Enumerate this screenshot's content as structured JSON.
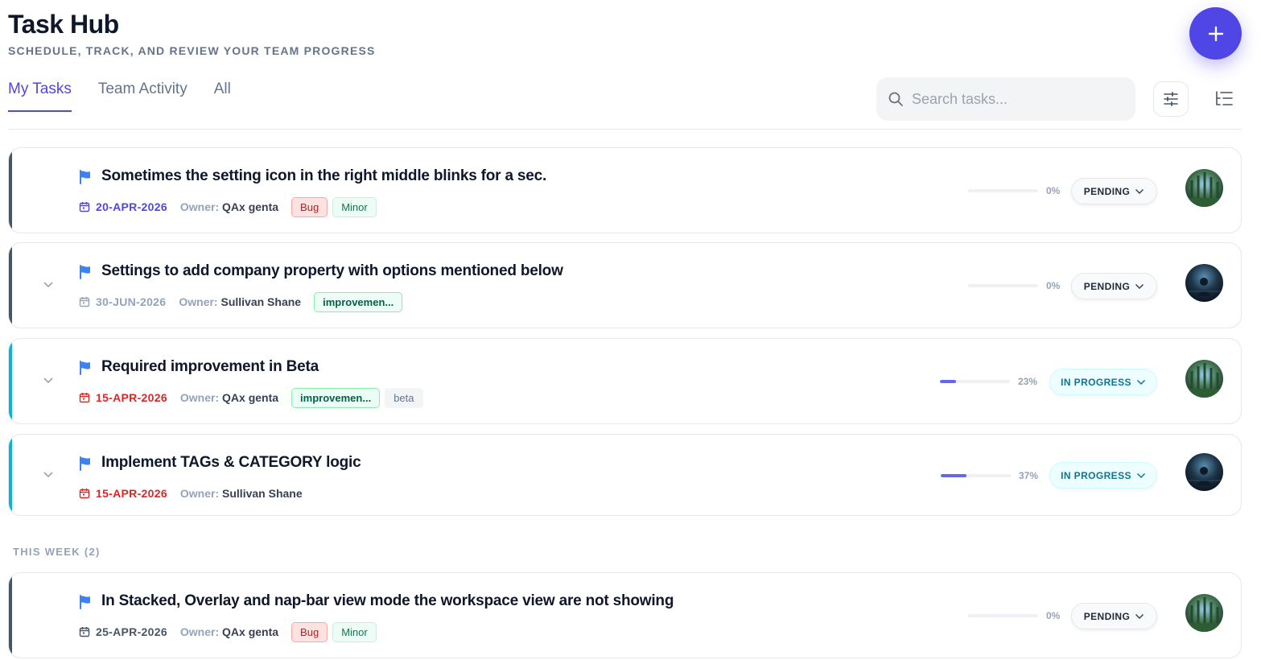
{
  "header": {
    "title": "Task Hub",
    "subtitle": "SCHEDULE, TRACK, AND REVIEW YOUR TEAM PROGRESS"
  },
  "tabs": [
    {
      "label": "My Tasks",
      "active": true
    },
    {
      "label": "Team Activity",
      "active": false
    },
    {
      "label": "All",
      "active": false
    }
  ],
  "search": {
    "placeholder": "Search tasks..."
  },
  "colors": {
    "accent": "#4f46e5",
    "overdue": "#dc2626",
    "upcoming": "#4f46e5",
    "muted_date": "#64748b",
    "pending_stripe": "#475569",
    "in_progress_stripe": "#06b6d4"
  },
  "tasks": [
    {
      "title": "Sometimes the setting icon in the right middle blinks for a sec.",
      "date": "20-APR-2026",
      "owner_label": "Owner:",
      "owner": "QAx genta",
      "tags": [
        "Bug",
        "Minor"
      ],
      "progress_percent": 0,
      "progress_label": "0%",
      "status": "PENDING",
      "expandable": false,
      "avatar": "forest-avatar"
    },
    {
      "title": "Settings to add company property with options mentioned below",
      "date": "30-JUN-2026",
      "owner_label": "Owner:",
      "owner": "Sullivan Shane",
      "tags": [
        "improvemen..."
      ],
      "progress_percent": 0,
      "progress_label": "0%",
      "status": "PENDING",
      "expandable": true,
      "avatar": "night-avatar"
    },
    {
      "title": "Required improvement in Beta",
      "date": "15-APR-2026",
      "owner_label": "Owner:",
      "owner": "QAx genta",
      "tags": [
        "improvemen...",
        "beta"
      ],
      "progress_percent": 23,
      "progress_label": "23%",
      "status": "IN PROGRESS",
      "expandable": true,
      "avatar": "forest-avatar"
    },
    {
      "title": "Implement TAGs & CATEGORY logic",
      "date": "15-APR-2026",
      "owner_label": "Owner:",
      "owner": "Sullivan Shane",
      "tags": [],
      "progress_percent": 37,
      "progress_label": "37%",
      "status": "IN PROGRESS",
      "expandable": true,
      "avatar": "night-avatar"
    }
  ],
  "section": {
    "label": "THIS WEEK (2)"
  },
  "week_tasks": [
    {
      "title": "In Stacked, Overlay and nap-bar view mode the workspace view are not showing",
      "date": "25-APR-2026",
      "owner_label": "Owner:",
      "owner": "QAx genta",
      "tags": [
        "Bug",
        "Minor"
      ],
      "progress_percent": 0,
      "progress_label": "0%",
      "status": "PENDING",
      "expandable": false,
      "avatar": "forest-avatar"
    }
  ]
}
